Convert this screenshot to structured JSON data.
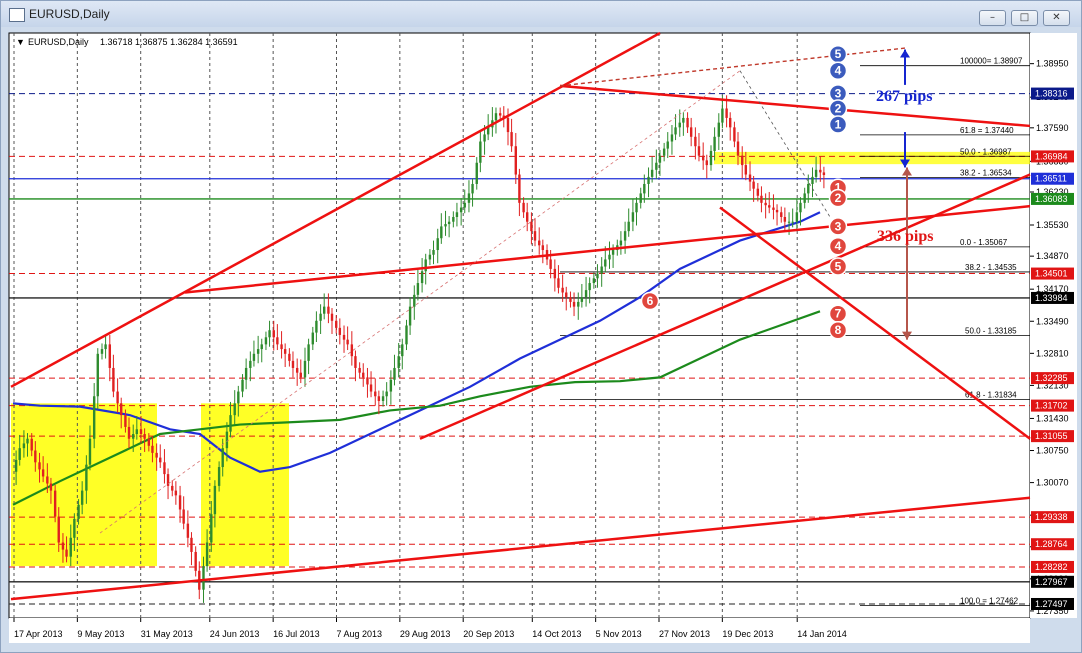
{
  "window": {
    "title": "EURUSD,Daily",
    "minimize_icon": "minimize-icon",
    "maximize_icon": "maximize-icon",
    "close_icon": "close-icon"
  },
  "chart_header": {
    "marker": "▼",
    "symbol": "EURUSD,Daily",
    "ohlc": "1.36718 1.36875 1.36284 1.36591"
  },
  "colors": {
    "bull": "#2e8b2e",
    "bear": "#e02020",
    "ma_blue": "#1f2fd8",
    "ma_green": "#1c8a1c",
    "trend_red": "#ee1111",
    "highlight": "#ffff00",
    "pip_blue": "#1525d0",
    "pip_red": "#e01515"
  },
  "chart_data": {
    "type": "candlestick",
    "symbol": "EURUSD",
    "timeframe": "Daily",
    "ohlc_last": {
      "open": 1.36718,
      "high": 1.36875,
      "low": 1.36284,
      "close": 1.36591
    },
    "ylim": [
      1.272,
      1.396
    ],
    "y_ticks": [
      "1.38950",
      "1.38240",
      "1.37590",
      "1.36880",
      "1.36230",
      "1.35530",
      "1.34870",
      "1.34170",
      "1.33490",
      "1.32810",
      "1.32130",
      "1.31430",
      "1.30750",
      "1.30070",
      "1.29380",
      "1.28710",
      "1.28030",
      "1.27350"
    ],
    "x_ticks": [
      "17 Apr 2013",
      "9 May 2013",
      "31 May 2013",
      "24 Jun 2013",
      "16 Jul 2013",
      "7 Aug 2013",
      "29 Aug 2013",
      "20 Sep 2013",
      "14 Oct 2013",
      "5 Nov 2013",
      "27 Nov 2013",
      "19 Dec 2013",
      "14 Jan 2014"
    ],
    "x_range": [
      "2013-04-17",
      "2014-01-24"
    ],
    "price_labels": [
      {
        "text": "1.38316",
        "price": 1.38316,
        "color": "#0b1a8a"
      },
      {
        "text": "1.36984",
        "price": 1.36984,
        "color": "#e01515"
      },
      {
        "text": "1.36511",
        "price": 1.36511,
        "color": "#1f2fd8"
      },
      {
        "text": "1.36083",
        "price": 1.36083,
        "color": "#1c8a1c"
      },
      {
        "text": "1.34501",
        "price": 1.34501,
        "color": "#e01515"
      },
      {
        "text": "1.33984",
        "price": 1.33984,
        "color": "#000000"
      },
      {
        "text": "1.32285",
        "price": 1.32285,
        "color": "#e01515"
      },
      {
        "text": "1.31702",
        "price": 1.31702,
        "color": "#e01515"
      },
      {
        "text": "1.31055",
        "price": 1.31055,
        "color": "#e01515"
      },
      {
        "text": "1.29338",
        "price": 1.29338,
        "color": "#e01515"
      },
      {
        "text": "1.28764",
        "price": 1.28764,
        "color": "#e01515"
      },
      {
        "text": "1.28282",
        "price": 1.28282,
        "color": "#e01515"
      },
      {
        "text": "1.27967",
        "price": 1.27967,
        "color": "#000000"
      },
      {
        "text": "1.27497",
        "price": 1.27497,
        "color": "#000000"
      }
    ],
    "fibo_levels": [
      {
        "text": "100000= 1.38907",
        "price": 1.38907
      },
      {
        "text": "61.8 = 1.37440",
        "price": 1.3744
      },
      {
        "text": "50.0 - 1.36987",
        "price": 1.36987
      },
      {
        "text": "38.2 - 1.36534",
        "price": 1.36534
      },
      {
        "text": "0.0 - 1.35067",
        "price": 1.35067
      },
      {
        "text": "38.2 - 1.34535",
        "price": 1.34535
      },
      {
        "text": "50.0 - 1.33185",
        "price": 1.33185
      },
      {
        "text": "61.8 - 1.31834",
        "price": 1.31834
      },
      {
        "text": "100.0 = 1.27462",
        "price": 1.27462
      }
    ],
    "annotations": [
      {
        "text": "267 pips",
        "color": "#1525d0"
      },
      {
        "text": "336 pips",
        "color": "#e01515"
      }
    ],
    "blue_markers": [
      "5",
      "4",
      "3",
      "2",
      "1"
    ],
    "red_markers": [
      "1",
      "2",
      "3",
      "4",
      "5",
      "6",
      "7",
      "8"
    ],
    "close_path": [
      1.303,
      1.308,
      1.31,
      1.305,
      1.302,
      1.299,
      1.288,
      1.285,
      1.293,
      1.299,
      1.31,
      1.328,
      1.33,
      1.32,
      1.315,
      1.31,
      1.312,
      1.31,
      1.307,
      1.305,
      1.3,
      1.298,
      1.292,
      1.286,
      1.278,
      1.288,
      1.3,
      1.308,
      1.315,
      1.32,
      1.325,
      1.328,
      1.33,
      1.333,
      1.33,
      1.328,
      1.325,
      1.323,
      1.33,
      1.335,
      1.338,
      1.335,
      1.332,
      1.33,
      1.325,
      1.323,
      1.32,
      1.318,
      1.32,
      1.325,
      1.33,
      1.338,
      1.343,
      1.348,
      1.35,
      1.355,
      1.356,
      1.358,
      1.36,
      1.364,
      1.373,
      1.376,
      1.379,
      1.378,
      1.372,
      1.36,
      1.356,
      1.352,
      1.35,
      1.346,
      1.342,
      1.34,
      1.338,
      1.34,
      1.343,
      1.345,
      1.348,
      1.35,
      1.352,
      1.356,
      1.36,
      1.364,
      1.367,
      1.37,
      1.373,
      1.376,
      1.378,
      1.374,
      1.37,
      1.368,
      1.374,
      1.38,
      1.376,
      1.37,
      1.366,
      1.363,
      1.36,
      1.359,
      1.358,
      1.356,
      1.356,
      1.36,
      1.364,
      1.367,
      1.3659
    ]
  }
}
